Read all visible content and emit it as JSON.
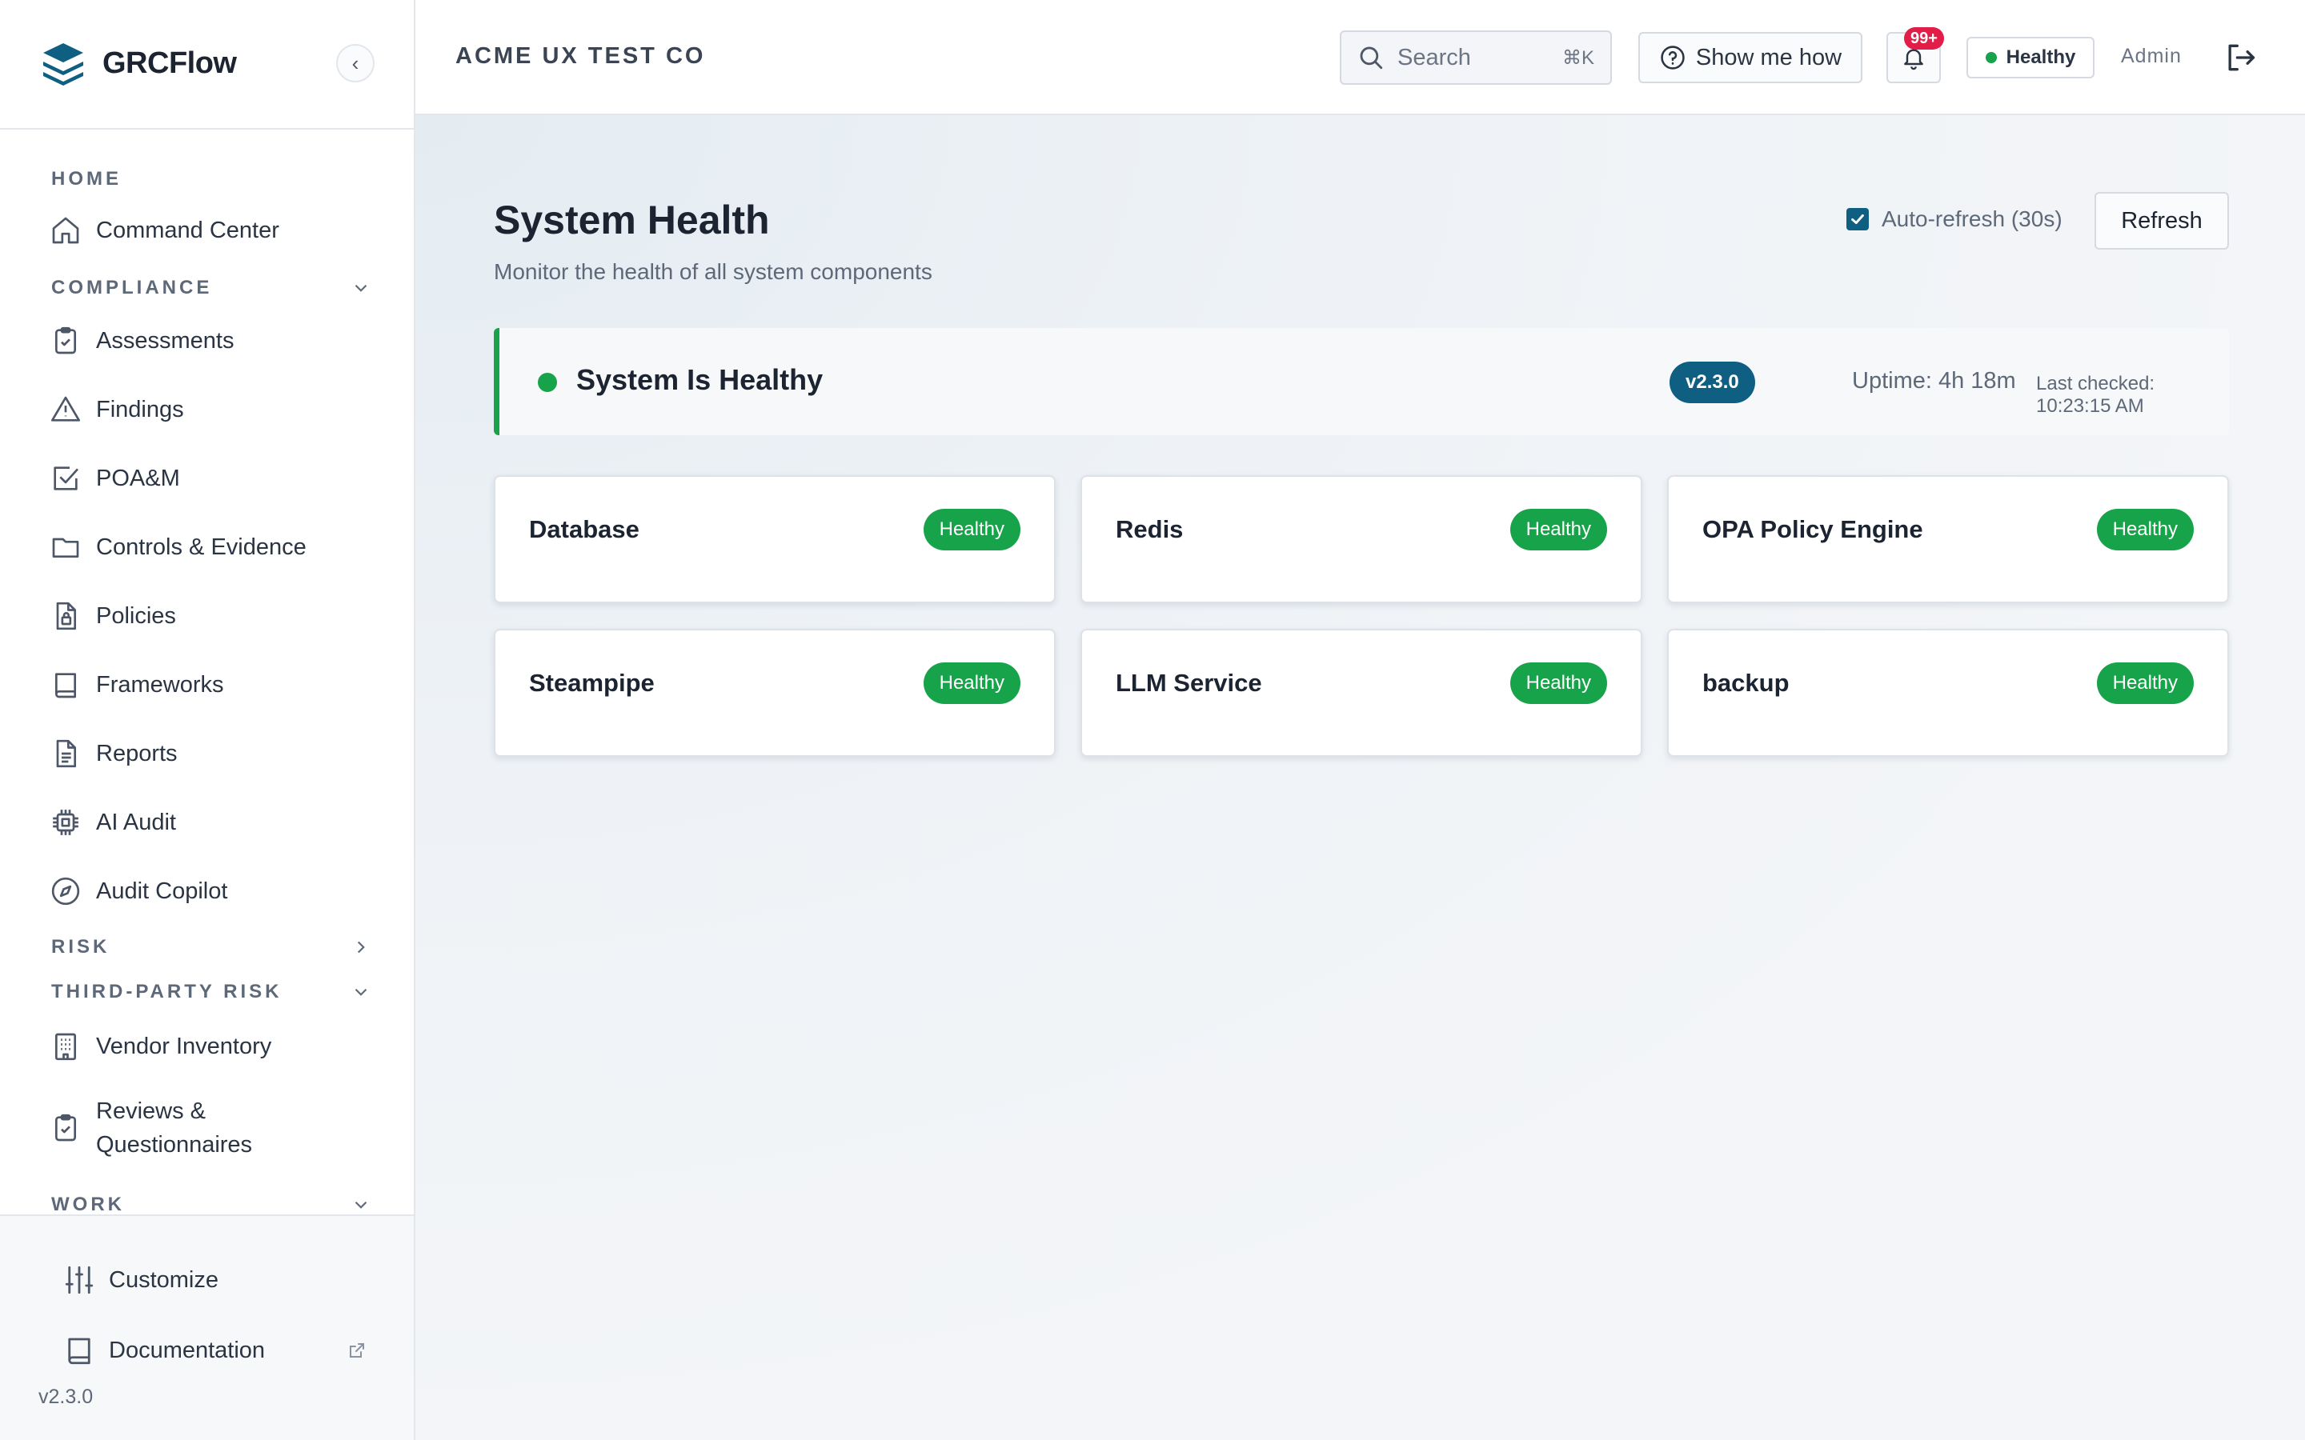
{
  "app": {
    "name": "GRCFlow",
    "version": "v2.3.0"
  },
  "header": {
    "org_name": "ACME UX TEST CO",
    "search_placeholder": "Search",
    "search_shortcut": "⌘K",
    "show_me_how": "Show me how",
    "notifications_count": "99+",
    "health_status": "Healthy",
    "user_role": "Admin"
  },
  "sidebar": {
    "sections": {
      "home": "HOME",
      "compliance": "COMPLIANCE",
      "risk": "RISK",
      "third_party_risk": "THIRD-PARTY RISK",
      "work": "WORK"
    },
    "items": {
      "command_center": "Command Center",
      "assessments": "Assessments",
      "findings": "Findings",
      "poam": "POA&M",
      "controls_evidence": "Controls & Evidence",
      "policies": "Policies",
      "frameworks": "Frameworks",
      "reports": "Reports",
      "ai_audit": "AI Audit",
      "audit_copilot": "Audit Copilot",
      "vendor_inventory": "Vendor Inventory",
      "reviews_line1": "Reviews &",
      "reviews_line2": "Questionnaires"
    },
    "footer": {
      "customize": "Customize",
      "documentation": "Documentation",
      "version": "v2.3.0"
    }
  },
  "page": {
    "title": "System Health",
    "subtitle": "Monitor the health of all system components",
    "auto_refresh_label": "Auto-refresh (30s)",
    "auto_refresh_checked": true,
    "refresh_button": "Refresh",
    "overall": {
      "status": "System Is Healthy",
      "version": "v2.3.0",
      "uptime": "Uptime: 4h 18m",
      "last_checked": "Last checked: 10:23:15 AM"
    },
    "components": [
      {
        "name": "Database",
        "status": "Healthy"
      },
      {
        "name": "Redis",
        "status": "Healthy"
      },
      {
        "name": "OPA Policy Engine",
        "status": "Healthy"
      },
      {
        "name": "Steampipe",
        "status": "Healthy"
      },
      {
        "name": "LLM Service",
        "status": "Healthy"
      },
      {
        "name": "backup",
        "status": "Healthy"
      }
    ]
  },
  "colors": {
    "accent": "#0f5f82",
    "healthy": "#16a34a",
    "notification": "#e11d48"
  }
}
